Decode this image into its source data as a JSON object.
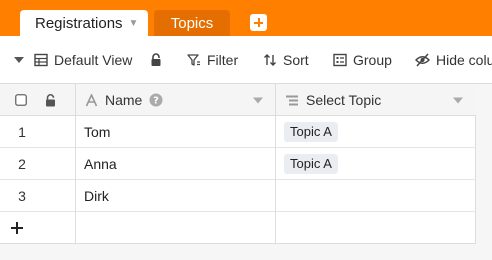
{
  "tabs": {
    "active": {
      "label": "Registrations"
    },
    "inactive": {
      "label": "Topics"
    }
  },
  "toolbar": {
    "view_label": "Default View",
    "filter_label": "Filter",
    "sort_label": "Sort",
    "group_label": "Group",
    "hide_label": "Hide colu"
  },
  "columns": {
    "name": {
      "label": "Name"
    },
    "topic": {
      "label": "Select Topic"
    }
  },
  "rows": [
    {
      "num": "1",
      "name": "Tom",
      "topic": "Topic A"
    },
    {
      "num": "2",
      "name": "Anna",
      "topic": "Topic A"
    },
    {
      "num": "3",
      "name": "Dirk",
      "topic": ""
    }
  ],
  "colors": {
    "brand": "#ff8000",
    "inactive_tab": "#e46f00",
    "chip": "#eaeef3"
  },
  "icons": {
    "add_table": "plus-square-icon",
    "view": "table-icon",
    "lock": "lock-icon",
    "filter": "filter-icon",
    "sort": "sort-arrows-icon",
    "group": "group-icon",
    "hide": "eye-off-icon",
    "name_type": "text-type-icon",
    "help": "question-circle-icon",
    "select_type": "list-icon",
    "add_row": "plus-icon"
  }
}
